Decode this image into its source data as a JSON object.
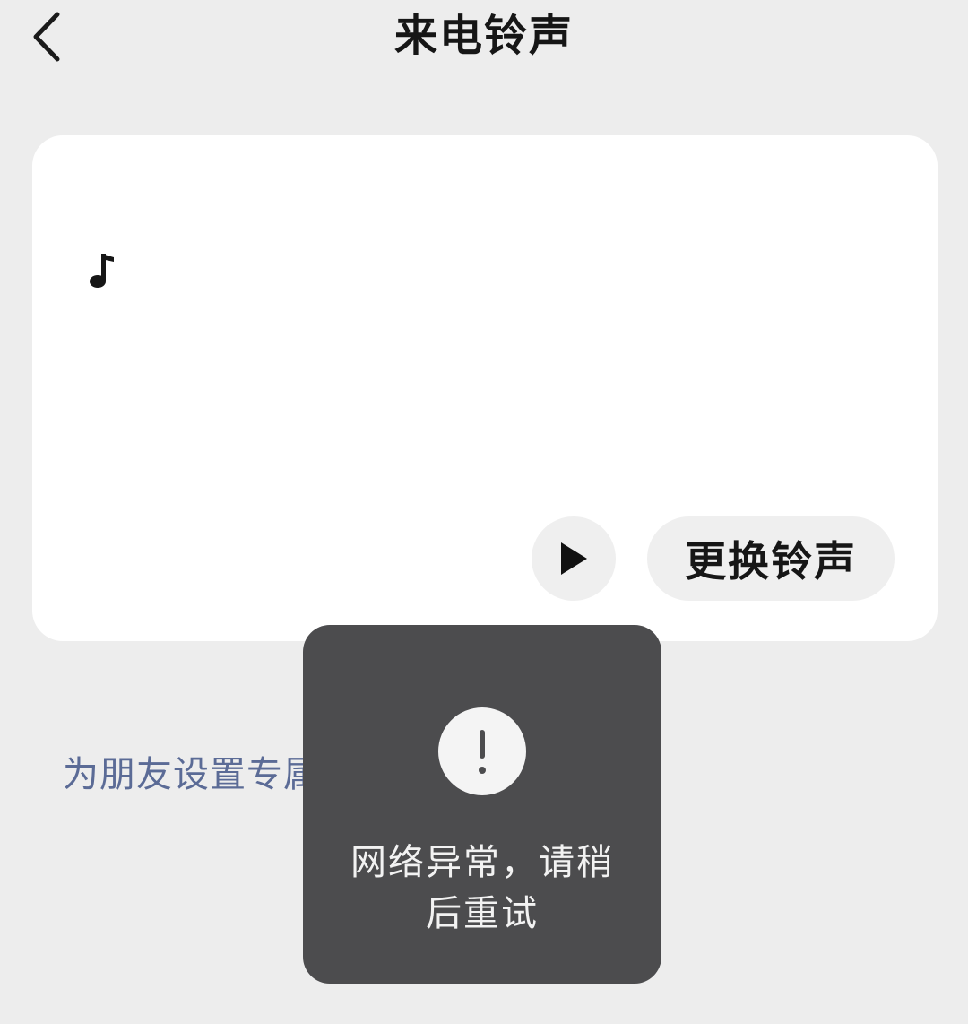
{
  "header": {
    "title": "来电铃声",
    "back_icon": "chevron-left-icon"
  },
  "card": {
    "music_icon": "music-note-icon",
    "play_icon": "play-icon",
    "change_button_label": "更换铃声"
  },
  "friend_link": {
    "label": "为朋友设置专属"
  },
  "toast": {
    "icon": "exclamation-icon",
    "message": "网络异常，请稍后重试"
  },
  "colors": {
    "background": "#ededed",
    "card": "#ffffff",
    "link": "#5b6b96",
    "toast": "#4c4c4e"
  }
}
